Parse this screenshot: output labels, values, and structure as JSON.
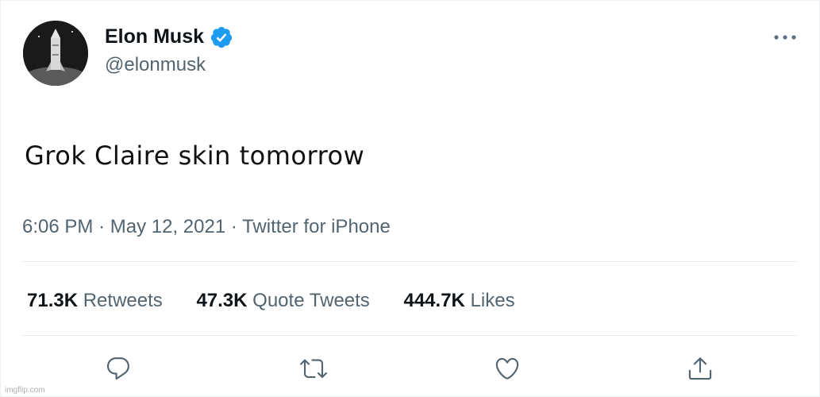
{
  "tweet": {
    "display_name": "Elon Musk",
    "handle": "@elonmusk",
    "text": "Grok Claire skin tomorrow",
    "time": "6:06 PM",
    "separator": "·",
    "date": "May 12, 2021",
    "source": "Twitter for iPhone"
  },
  "stats": {
    "retweets_count": "71.3K",
    "retweets_label": "Retweets",
    "quotes_count": "47.3K",
    "quotes_label": "Quote Tweets",
    "likes_count": "444.7K",
    "likes_label": "Likes"
  },
  "icons": {
    "verified": "verified-badge-icon",
    "more": "more-options-icon",
    "reply": "reply-icon",
    "retweet": "retweet-icon",
    "like": "heart-icon",
    "share": "share-icon"
  },
  "colors": {
    "verified_blue": "#1d9bf0",
    "secondary_text": "#536471",
    "primary_text": "#0f1419"
  },
  "watermark": "imgflip.com"
}
